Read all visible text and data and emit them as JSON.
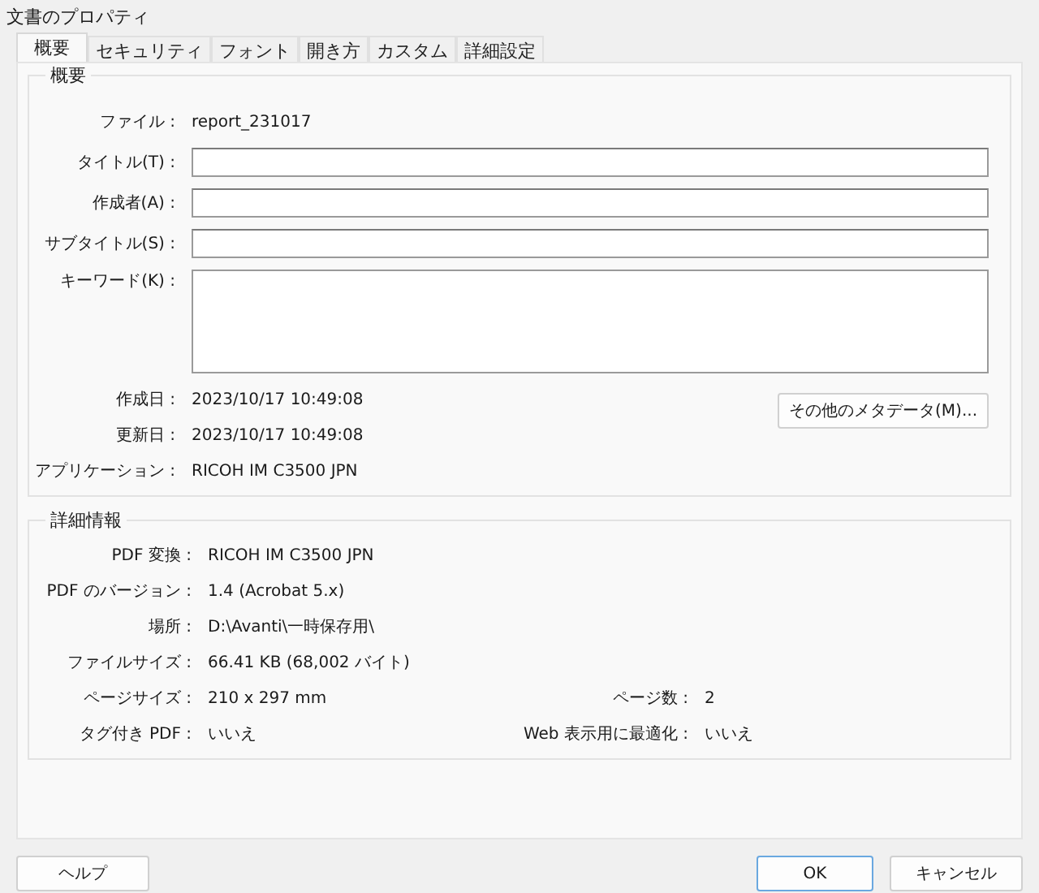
{
  "window": {
    "title": "文書のプロパティ"
  },
  "tabs": [
    {
      "label": "概要",
      "selected": true
    },
    {
      "label": "セキュリティ",
      "selected": false
    },
    {
      "label": "フォント",
      "selected": false
    },
    {
      "label": "開き方",
      "selected": false
    },
    {
      "label": "カスタム",
      "selected": false
    },
    {
      "label": "詳細設定",
      "selected": false
    }
  ],
  "summary": {
    "heading": "概要",
    "fields": [
      {
        "label": "ファイル :",
        "kind": "text",
        "value": "report_231017"
      },
      {
        "label": "タイトル(T) :",
        "kind": "input"
      },
      {
        "label": "作成者(A) :",
        "kind": "input"
      },
      {
        "label": "サブタイトル(S) :",
        "kind": "input"
      },
      {
        "label": "キーワード(K) :",
        "kind": "textarea"
      }
    ],
    "info": [
      {
        "label": "作成日 :",
        "value": "2023/10/17 10:49:08"
      },
      {
        "label": "更新日 :",
        "value": "2023/10/17 10:49:08"
      },
      {
        "label": "アプリケーション :",
        "value": "RICOH IM C3500 JPN"
      }
    ],
    "metadata_button": "その他のメタデータ(M)..."
  },
  "details": {
    "heading": "詳細情報",
    "rows": [
      [
        {
          "label": "PDF 変換 :",
          "value": "RICOH IM C3500 JPN"
        }
      ],
      [
        {
          "label": "PDF のバージョン :",
          "value": "1.4 (Acrobat 5.x)"
        }
      ],
      [
        {
          "label": "場所 :",
          "value": "D:\\Avanti\\一時保存用\\"
        }
      ],
      [
        {
          "label": "ファイルサイズ :",
          "value": "66.41 KB (68,002 バイト)"
        }
      ],
      [
        {
          "label": "ページサイズ :",
          "value": "210 x 297 mm"
        },
        {
          "label": "ページ数 :",
          "value": "2"
        }
      ],
      [
        {
          "label": "タグ付き PDF :",
          "value": "いいえ"
        },
        {
          "label": "Web 表示用に最適化 :",
          "value": "いいえ"
        }
      ]
    ]
  },
  "footer": {
    "left": [
      {
        "label": "ヘルプ",
        "default": false
      }
    ],
    "right": [
      {
        "label": "OK",
        "default": true
      },
      {
        "label": "キャンセル",
        "default": false
      }
    ]
  }
}
